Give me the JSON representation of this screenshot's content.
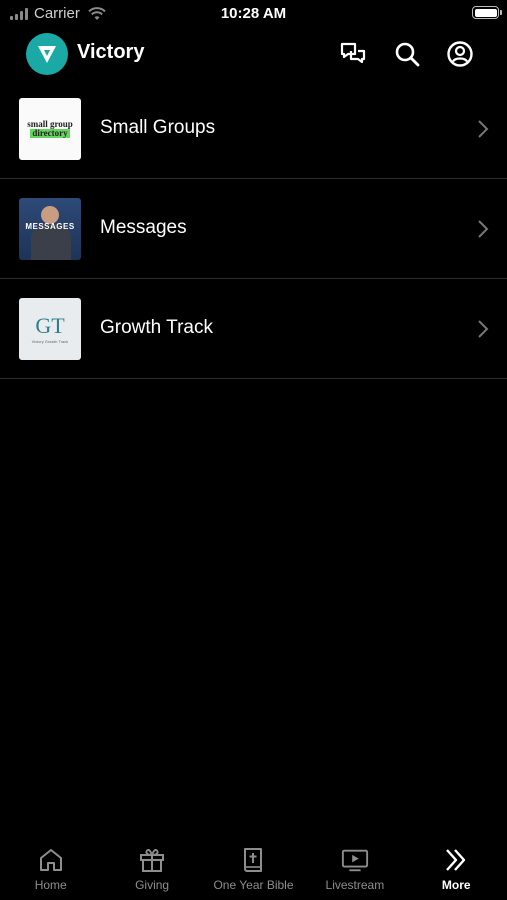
{
  "status_bar": {
    "carrier": "Carrier",
    "time": "10:28 AM"
  },
  "header": {
    "title": "Victory",
    "logo_icon": "victory-logo-icon",
    "accent_color": "#1aa9a5",
    "actions": [
      "chat-icon",
      "search-icon",
      "profile-icon"
    ]
  },
  "list": {
    "items": [
      {
        "label": "Small Groups",
        "thumb_text_1": "small group",
        "thumb_text_2": "directory"
      },
      {
        "label": "Messages",
        "thumb_text": "MESSAGES"
      },
      {
        "label": "Growth Track",
        "thumb_text": "GT",
        "thumb_subtext": "Victory Growth Track"
      }
    ]
  },
  "tabbar": {
    "tabs": [
      {
        "label": "Home",
        "icon": "home-icon",
        "active": false
      },
      {
        "label": "Giving",
        "icon": "gift-icon",
        "active": false
      },
      {
        "label": "One Year Bible",
        "icon": "bible-icon",
        "active": false
      },
      {
        "label": "Livestream",
        "icon": "livestream-icon",
        "active": false
      },
      {
        "label": "More",
        "icon": "more-icon",
        "active": true
      }
    ]
  }
}
